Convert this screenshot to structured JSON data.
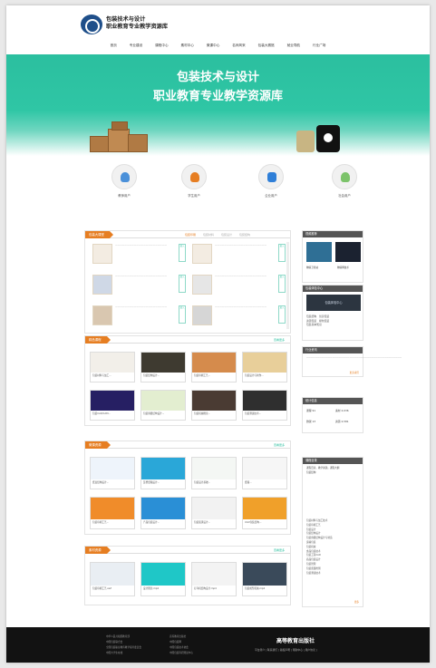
{
  "header": {
    "logo_line1": "包装技术与设计",
    "logo_line2": "职业教育专业教学资源库"
  },
  "nav": [
    "首页",
    "专业建设",
    "课程中心",
    "素材中心",
    "微课中心",
    "名师风采",
    "包装大赛馆",
    "就业导航",
    "行业广场"
  ],
  "banner": {
    "title_line1": "包装技术与设计",
    "title_line2": "职业教育专业教学资源库"
  },
  "roles": [
    {
      "label": "教师用户",
      "icon": "teacher-user-icon",
      "color": "#4a90d9"
    },
    {
      "label": "学生用户",
      "icon": "student-user-icon",
      "color": "#e67e22"
    },
    {
      "label": "企业用户",
      "icon": "enterprise-user-icon",
      "color": "#2f7fd8"
    },
    {
      "label": "社会用户",
      "icon": "public-user-icon",
      "color": "#7cc36a"
    }
  ],
  "course_panel": {
    "tag": "包装大课堂",
    "tabs": [
      "包装印刷",
      "包装材料",
      "包装设计",
      "包装结构"
    ]
  },
  "sidebar": {
    "guide_title": "视频推荐",
    "guide_items": [
      "物联卫星站",
      "物联网技术"
    ],
    "center_title": "包装体验中心",
    "center_image_text": "包装体验中心",
    "center_links": [
      "包装结构",
      "创意包装",
      "资源包装",
      "绿色包装",
      "包装基本知识"
    ],
    "news_title": "行业资讯",
    "news_more": "更多资讯",
    "stats_title": "统计信息",
    "stats": [
      {
        "label": "课程",
        "value": "91"
      },
      {
        "label": "素材",
        "value": "2,036"
      },
      {
        "label": "微课",
        "value": "13"
      },
      {
        "label": "资源",
        "value": "2,581"
      }
    ],
    "list_title": "课程目录",
    "list_sub": "课程目录，教学资源，课程大纲",
    "list_sub2": "包装结构",
    "list_items": [
      "包装材料与加工技术",
      "包装印刷工艺",
      "包装设计",
      "包装结构设计",
      "包装容器结构设计与制造",
      "运输包装",
      "包装机械",
      "食品包装技术",
      "包装工程CAD",
      "商品包装设计",
      "包装管理",
      "包装质量检测",
      "包装测试技术"
    ],
    "list_more": "更多"
  },
  "featured_courses": {
    "tag": "精品课程",
    "more": "查看更多",
    "items": [
      "包装材料与加工...",
      "包装结构设计...",
      "包装印刷工艺...",
      "包装设计与制作...",
      "包装CAD/CAM...",
      "包装容器结构设计...",
      "包装机械概论...",
      "包装测试技术..."
    ]
  },
  "micro_courses": {
    "tag": "微课资源",
    "more": "查看更多",
    "items": [
      "纸盒结构设计...",
      "瓦楞纸箱设计...",
      "包装设计基础...",
      "纸箱...",
      "包装印刷工艺...",
      "产品包装设计...",
      "包装装潢设计...",
      "CAD包装结构..."
    ]
  },
  "materials": {
    "tag": "素材资源",
    "more": "查看更多",
    "items": [
      "包装印刷工艺.swf",
      "设计理念.mp4",
      "打印机结构设计.mp4",
      "包装成型机械.mp4"
    ]
  },
  "footer": {
    "col1": [
      "中华人民共和国教育部",
      "中国包装联合会",
      "全国包装职业教育教学指导委员会",
      "中国大学生在线"
    ],
    "col2": [
      "高等教育出版社",
      "中国包装网",
      "中国包装技术协会",
      "中国包装科研测试中心"
    ],
    "brand": "高等教育出版社",
    "links": "平台简介 | 联系我们 | 版权声明 | 帮助中心 | 用户协议 |"
  },
  "colors": {
    "accent": "#2bbf9f",
    "orange": "#e67e22",
    "dark": "#121212"
  }
}
